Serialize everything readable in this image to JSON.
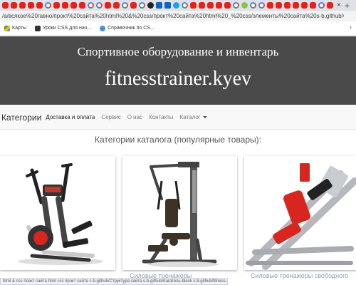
{
  "browser": {
    "tab_icons": [
      "youtube-icon",
      "youtube-icon",
      "youtube-icon",
      "youtube-icon",
      "youtube-icon",
      "google-icon",
      "youtube-icon",
      "youtube-icon",
      "youtube-icon",
      "youtube-icon",
      "google-icon",
      "google-icon",
      "youtube-icon",
      "youtube-icon",
      "google-icon",
      "youtube-icon",
      "google-icon",
      "github-icon",
      "linkedin-icon",
      "linkedin-icon",
      "bootstrap-icon",
      "google-icon",
      "youtube-icon",
      "youtube-icon",
      "youtube-icon",
      "youtube-icon",
      "youtube-icon",
      "google-icon",
      "chrome-icon",
      "google-icon",
      "google-icon",
      "youtube-icon",
      "youtube-icon",
      "youtube-icon",
      "youtube-icon",
      "youtube-icon",
      "youtube-icon",
      "google-icon",
      "youtube-icon"
    ],
    "tab_close": "×",
    "new_tab": "+",
    "url": "/a/всякое%20гавно/прокт%20сайта%20html%20&%20css/прокт%20сайта%20html%20_%20css/элементы%20сайта%20s-b.github/Структура%20сайта%20s-b.github%20_%20ht...",
    "bookmarks": [
      {
        "label": "Карты",
        "icon": "maps-icon"
      },
      {
        "label": "Уроки CSS для нач...",
        "icon": "css-lessons-icon"
      },
      {
        "label": "Справочник по CS...",
        "icon": "reference-icon"
      }
    ],
    "bookmarks_more": "›",
    "status_text": "html & css поэкт сайта html   css прокт сайта s-b.github/Структура сайта s-b.github/Кагатель-black s-b.github/fitness-shop.github..."
  },
  "hero": {
    "subtitle": "Спортивное оборудование и инвентарь",
    "title": "fitnesstrainer.kyev"
  },
  "nav": {
    "brand": "Категории",
    "links": [
      "Доставка и оплата",
      "Сервис",
      "О нас",
      "Контакты"
    ],
    "catalog": "Каталог"
  },
  "catalog": {
    "heading": "Категории каталога (популярные товары):",
    "cards": [
      {
        "name": "elliptical-trainer-image"
      },
      {
        "name": "multi-station-image"
      },
      {
        "name": "leg-press-image"
      }
    ],
    "captions": [
      "Силовые тренажеры",
      "Силовые тренажеры свободного"
    ]
  },
  "colors": {
    "hero_bg": "#4a4a4a",
    "nav_bg": "#f8f8f8",
    "accent_red": "#d7261f"
  }
}
